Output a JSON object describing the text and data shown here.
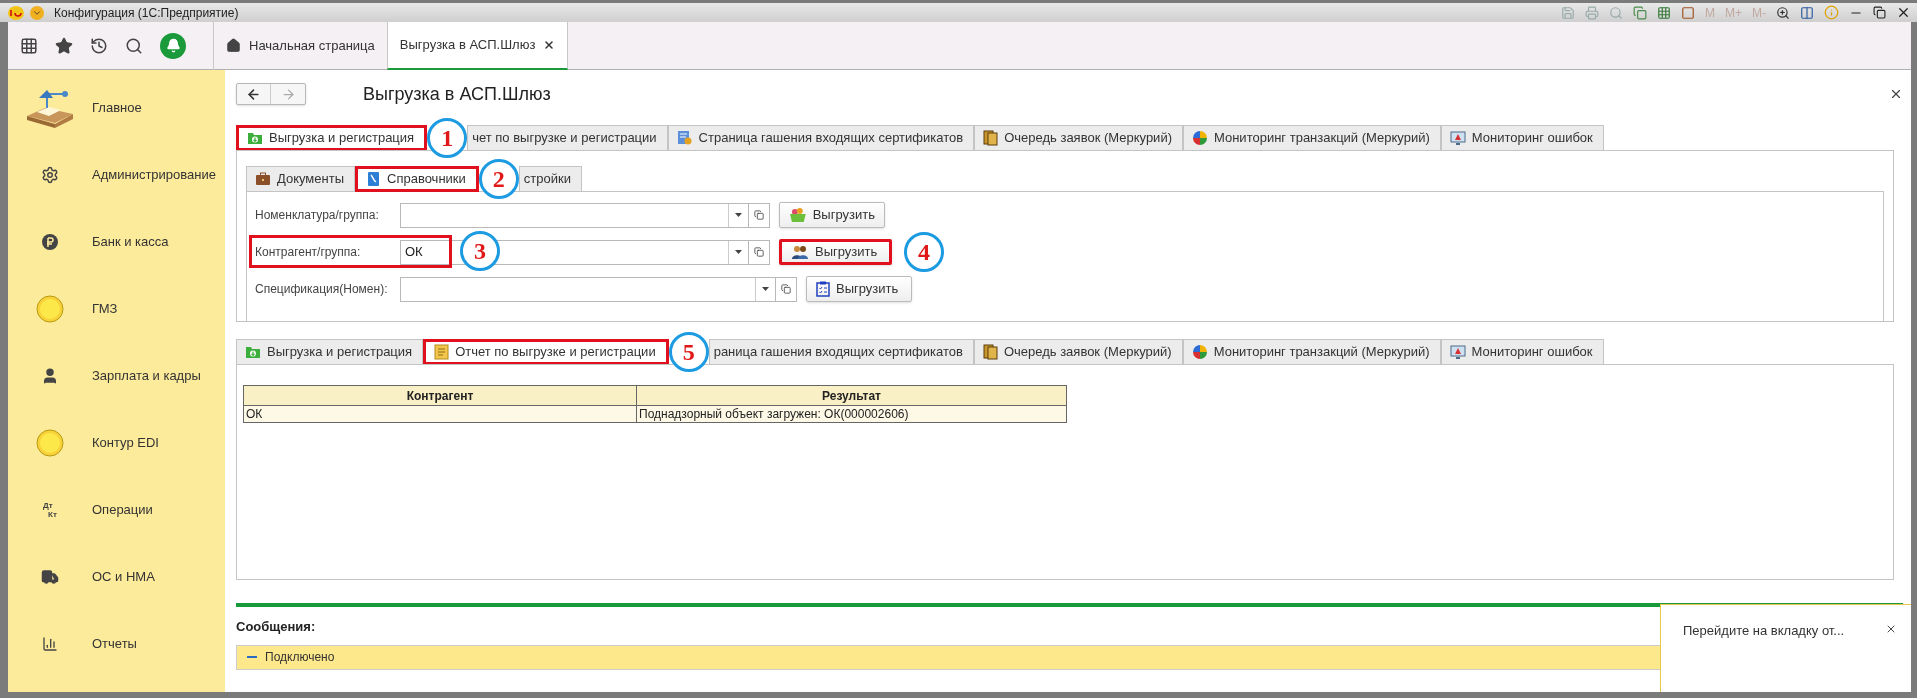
{
  "window": {
    "title": "Конфигурация (1С:Предприятие)",
    "memory_buttons": [
      "M",
      "M+",
      "M-"
    ]
  },
  "toolbar": {
    "tabs": [
      {
        "label": "Начальная страница",
        "selected": false,
        "kind": "home"
      },
      {
        "label": "Выгрузка в АСП.Шлюз",
        "selected": true,
        "kind": "page"
      }
    ]
  },
  "sidebar": {
    "items": [
      {
        "label": "Главное",
        "kind": "desk"
      },
      {
        "label": "Администрирование",
        "kind": "gear"
      },
      {
        "label": "Банк и касса",
        "kind": "ruble"
      },
      {
        "label": "ГМЗ",
        "kind": "coin"
      },
      {
        "label": "Зарплата и кадры",
        "kind": "person"
      },
      {
        "label": "Контур EDI",
        "kind": "coin"
      },
      {
        "label": "Операции",
        "kind": "text",
        "icon_text": [
          "Дт",
          "Кт"
        ]
      },
      {
        "label": "ОС и НМА",
        "kind": "truck"
      },
      {
        "label": "Отчеты",
        "kind": "bars"
      }
    ]
  },
  "form": {
    "title": "Выгрузка в АСП.Шлюз",
    "top_tabs": [
      {
        "label": "Выгрузка и регистрация",
        "kind": "upload",
        "selected": true,
        "highlighted": true,
        "callout": "1"
      },
      {
        "label": "чет по выгрузке и регистрации",
        "kind": "none",
        "selected": false,
        "highlighted": false
      },
      {
        "label": "Страница гашения входящих сертификатов",
        "kind": "certificate",
        "selected": false,
        "highlighted": false
      },
      {
        "label": "Очередь заявок (Меркурий)",
        "kind": "queue",
        "selected": false,
        "highlighted": false
      },
      {
        "label": "Мониторинг транзакций (Меркурий)",
        "kind": "pie",
        "selected": false,
        "highlighted": false
      },
      {
        "label": "Мониторинг ошибок",
        "kind": "monitor",
        "selected": false,
        "highlighted": false
      }
    ],
    "inner_tabs": [
      {
        "label": "Документы",
        "kind": "briefcase",
        "selected": false,
        "highlighted": false
      },
      {
        "label": "Справочники",
        "kind": "book",
        "selected": true,
        "highlighted": true,
        "callout": "2"
      },
      {
        "label": "стройки",
        "kind": "none",
        "selected": false,
        "highlighted": false
      }
    ],
    "rows": [
      {
        "label": "Номенклатура/группа:",
        "value": "",
        "button": {
          "label": "Выгрузить",
          "kind": "basket"
        },
        "highlighted": false,
        "button_highlighted": false
      },
      {
        "label": "Контрагент/группа:",
        "value": "ОК",
        "button": {
          "label": "Выгрузить",
          "kind": "people"
        },
        "highlighted": true,
        "callout": "3",
        "button_highlighted": true,
        "button_callout": "4"
      },
      {
        "label": "Спецификация(Номен):",
        "value": "",
        "button": {
          "label": "Выгрузить",
          "kind": "clipboard"
        },
        "highlighted": false,
        "button_highlighted": false
      }
    ],
    "bottom_tabs": [
      {
        "label": "Выгрузка и регистрация",
        "kind": "upload",
        "selected": false,
        "highlighted": false
      },
      {
        "label": "Отчет по выгрузке и регистрации",
        "kind": "report",
        "selected": true,
        "highlighted": true,
        "callout": "5"
      },
      {
        "label": "раница гашения входящих сертификатов",
        "kind": "none",
        "selected": false,
        "highlighted": false
      },
      {
        "label": "Очередь заявок (Меркурий)",
        "kind": "queue",
        "selected": false,
        "highlighted": false
      },
      {
        "label": "Мониторинг транзакций (Меркурий)",
        "kind": "pie",
        "selected": false,
        "highlighted": false
      },
      {
        "label": "Мониторинг ошибок",
        "kind": "monitor",
        "selected": false,
        "highlighted": false
      }
    ],
    "table": {
      "columns": [
        "Контрагент",
        "Результат"
      ],
      "rows": [
        [
          "ОК",
          "Поднадзорный объект загружен: ОК(000002606)"
        ]
      ]
    }
  },
  "messages": {
    "title": "Сообщения:",
    "items": [
      {
        "text": "Подключено"
      }
    ]
  },
  "notification": {
    "text": "Перейдите на вкладку от..."
  }
}
